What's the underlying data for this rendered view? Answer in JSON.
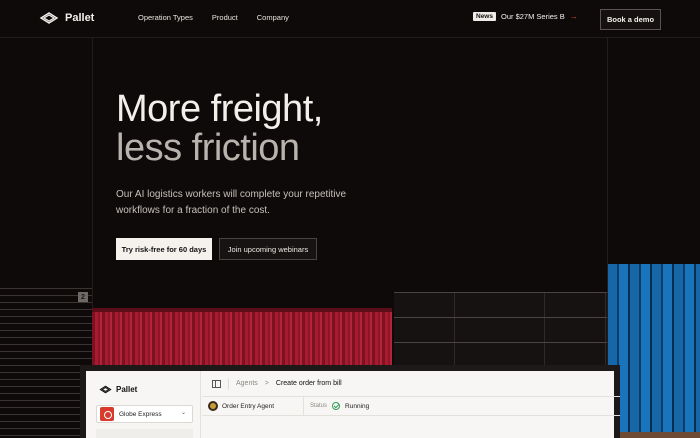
{
  "nav": {
    "brand": "Pallet",
    "links": [
      "Operation Types",
      "Product",
      "Company"
    ],
    "news_badge": "News",
    "news_text": "Our $27M Series B",
    "news_arrow": "→",
    "cta": "Book a demo"
  },
  "hero": {
    "title_line1": "More freight,",
    "title_line2": "less friction",
    "subtitle": "Our AI logistics workers will complete your repetitive workflows for a fraction of the cost.",
    "primary_button": "Try risk-free for 60 days",
    "secondary_button": "Join upcoming webinars"
  },
  "illustration": {
    "shelf_number": "2",
    "colors": {
      "container": "#a81a2f",
      "pallets": "#1767a8"
    }
  },
  "app_preview": {
    "brand": "Pallet",
    "org": "Globe Express",
    "org_chevron": "⌄",
    "breadcrumb_root": "Agents",
    "breadcrumb_sep": ">",
    "breadcrumb_current": "Create order from bill",
    "agent_name": "Order Entry Agent",
    "status_label": "Status",
    "status_value": "Running"
  },
  "colors": {
    "background": "#0d0a09",
    "text": "#f3f0ec",
    "accent_red": "#e0483e",
    "status_green": "#2f9e59"
  }
}
